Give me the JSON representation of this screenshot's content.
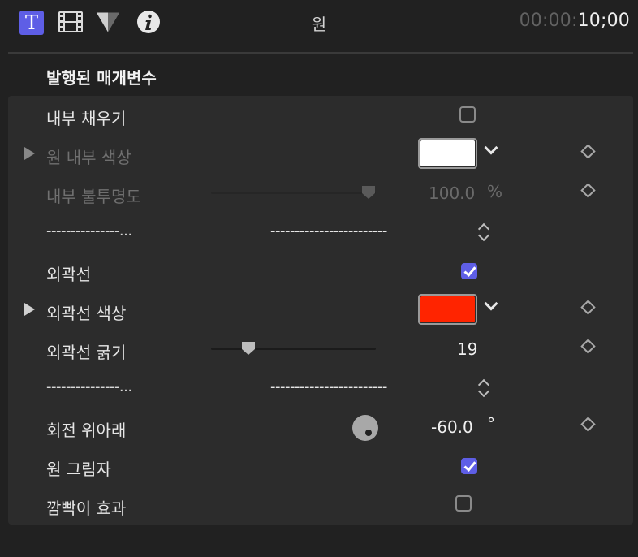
{
  "header": {
    "title": "원",
    "timecode_dim": "00:00:",
    "timecode_bright": "10;00",
    "toolbar_icons": [
      "text-inspector-icon",
      "video-inspector-icon",
      "generator-inspector-icon",
      "info-inspector-icon"
    ],
    "text_icon_glyph": "T"
  },
  "section": {
    "label": "발행된 매개변수"
  },
  "params": {
    "inner_fill": {
      "label": "내부 채우기",
      "checked": false
    },
    "inner_color": {
      "label": "원 내부 색상",
      "color": "#ffffff"
    },
    "inner_opacity": {
      "label": "내부 불투명도",
      "value": "100.0",
      "unit": "%",
      "level": 1.0
    },
    "divider1": {
      "label": "---------------...",
      "popup": "------------------------"
    },
    "outline": {
      "label": "외곽선",
      "checked": true
    },
    "outline_color": {
      "label": "외곽선 색상",
      "color": "#ff2400"
    },
    "outline_width": {
      "label": "외곽선 굵기",
      "value": "19",
      "level": 0.2
    },
    "divider2": {
      "label": "---------------...",
      "popup": "------------------------"
    },
    "rotate": {
      "label": "회전 위아래",
      "value": "-60.0",
      "unit": "°"
    },
    "shadow": {
      "label": "원 그림자",
      "checked": true
    },
    "blink": {
      "label": "깜빡이 효과",
      "checked": false
    }
  },
  "colors": {
    "accent": "#5e5ee6",
    "panel": "#2c2c2c",
    "background": "#212121"
  }
}
